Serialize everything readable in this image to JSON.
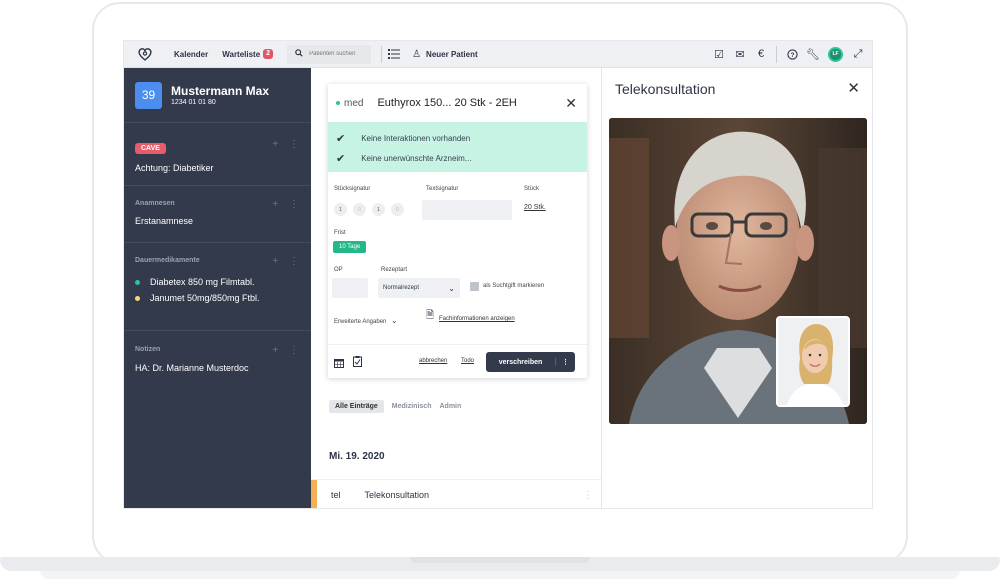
{
  "topbar": {
    "nav": [
      {
        "label": "Kalender"
      },
      {
        "label": "Warteliste",
        "badge": "2"
      }
    ],
    "search_placeholder": "Patienten suchen",
    "new_patient": "Neuer Patient",
    "avatar_initials": "LF",
    "icons": [
      "checkbox-icon",
      "mail-icon",
      "euro-icon",
      "help-icon",
      "wrench-icon",
      "expand-icon"
    ]
  },
  "patient": {
    "number": "39",
    "name": "Mustermann Max",
    "id": "1234 01 01 80"
  },
  "sidebar": {
    "cave_label": "CAVE",
    "cave_text": "Achtung: Diabetiker",
    "anamnesen_title": "Anamnesen",
    "anamnesen_text": "Erstanamnese",
    "dauermed_title": "Dauermedikamente",
    "meds": [
      {
        "label": "Diabetex 850 mg Filmtabl.",
        "color": "#2bc596"
      },
      {
        "label": "Janumet 50mg/850mg Ftbl.",
        "color": "#f5d77a"
      }
    ],
    "notizen_title": "Notizen",
    "notizen_text": "HA: Dr. Marianne Musterdoc"
  },
  "prescription": {
    "brand": "med",
    "title": "Euthyrox 150... 20 Stk - 2EH",
    "checks": [
      "Keine Interaktionen vorhanden",
      "Keine unerwünschte Arzneim..."
    ],
    "stueck_signatur_label": "Stücksignatur",
    "dosage": [
      "1",
      "0",
      "1",
      "0"
    ],
    "text_signatur_label": "Textsignatur",
    "stueck_label": "Stück",
    "stueck_value": "20 Stk.",
    "frist_label": "Frist",
    "frist_value": "10 Tage",
    "op_label": "OP",
    "rezeptart_label": "Rezeptart",
    "rezeptart_value": "Normalrezept",
    "suchtgift_label": "als Suchtgift markieren",
    "erweitert_label": "Erweiterte Angaben",
    "fachinfo_label": "Fachinformationen anzeigen",
    "cancel_label": "abbrechen",
    "todo_label": "Todo",
    "submit_label": "verschreiben"
  },
  "filters": [
    "Alle Einträge",
    "Medizinisch",
    "Admin"
  ],
  "timeline": {
    "date": "Mi. 19. 2020",
    "entry_type": "tel",
    "entry_title": "Telekonsultation"
  },
  "tele": {
    "title": "Telekonsultation"
  }
}
